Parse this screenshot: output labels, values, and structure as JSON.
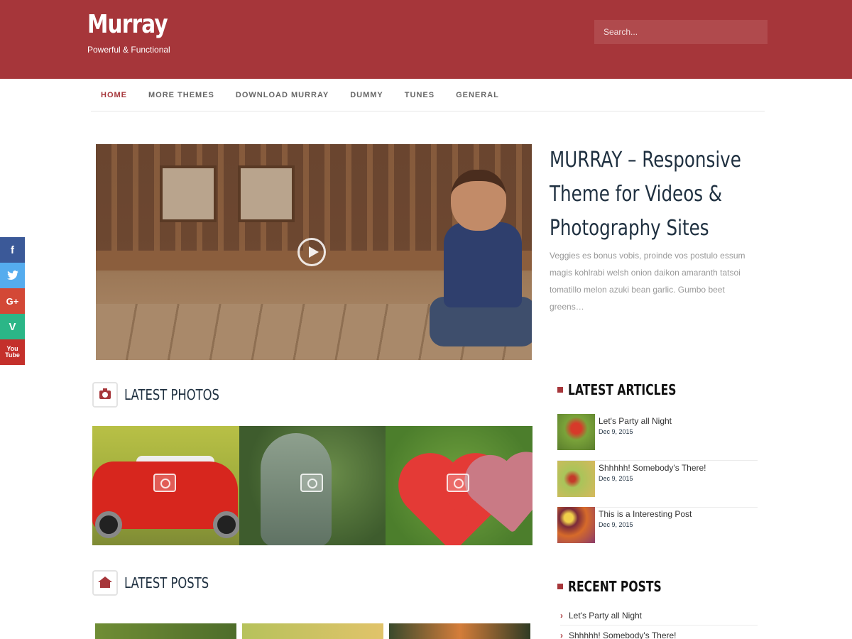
{
  "site": {
    "title": "Murray",
    "tagline": "Powerful & Functional",
    "search_placeholder": "Search..."
  },
  "nav": {
    "items": [
      {
        "label": "HOME",
        "active": true
      },
      {
        "label": "MORE THEMES",
        "active": false
      },
      {
        "label": "DOWNLOAD MURRAY",
        "active": false
      },
      {
        "label": "DUMMY",
        "active": false
      },
      {
        "label": "TUNES",
        "active": false
      },
      {
        "label": "GENERAL",
        "active": false
      }
    ]
  },
  "social": {
    "facebook": "f",
    "twitter": "🐦",
    "googleplus": "G+",
    "vine": "V",
    "youtube": "You Tube"
  },
  "featured": {
    "title": "MURRAY – Responsive Theme for Videos & Photography Sites",
    "excerpt": "Veggies es bonus vobis, proinde vos postulo essum magis kohlrabi welsh onion daikon amaranth tatsoi tomatillo melon azuki bean garlic. Gumbo beet greens…"
  },
  "sections": {
    "photos_title": "LATEST PHOTOS",
    "posts_title": "LATEST POSTS"
  },
  "sidebar": {
    "latest_articles_title": "LATEST ARTICLES",
    "articles": [
      {
        "title": "Let's Party all Night",
        "date": "Dec 9, 2015"
      },
      {
        "title": "Shhhhh! Somebody's There!",
        "date": "Dec 9, 2015"
      },
      {
        "title": "This is a Interesting Post",
        "date": "Dec 9, 2015"
      }
    ],
    "recent_posts_title": "RECENT POSTS",
    "recent": [
      {
        "title": "Let's Party all Night"
      },
      {
        "title": "Shhhhh! Somebody's There!"
      }
    ]
  },
  "colors": {
    "accent": "#a6363a",
    "facebook": "#3b5998",
    "twitter": "#55acee",
    "googleplus": "#d34836",
    "vine": "#2bb687",
    "youtube": "#c4302b"
  }
}
